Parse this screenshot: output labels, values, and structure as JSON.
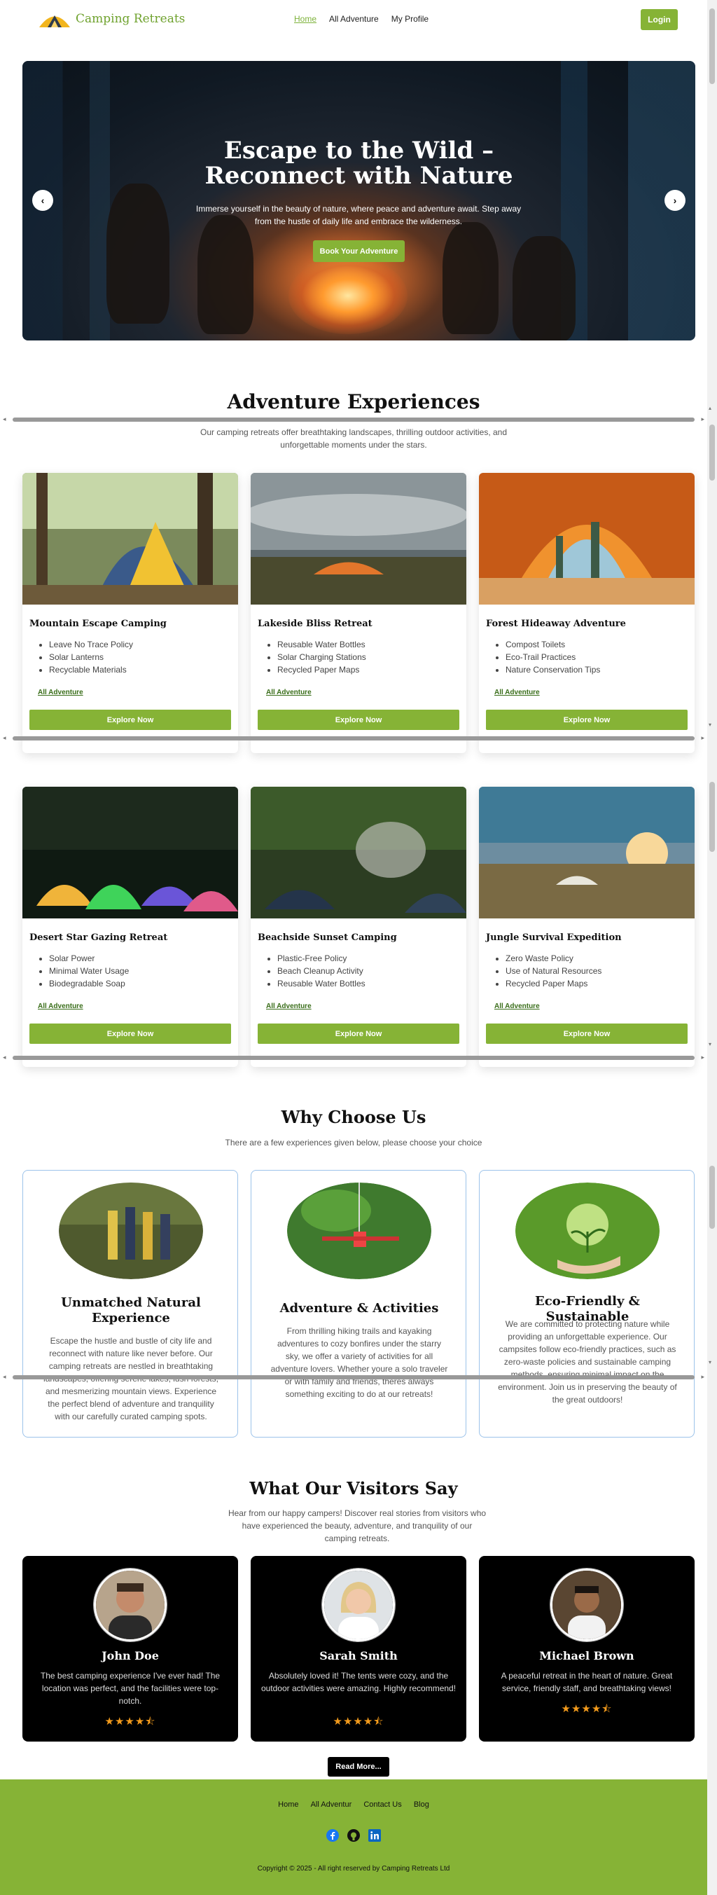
{
  "nav": {
    "brand": "Camping Retreats",
    "links": [
      "Home",
      "All Adventure",
      "My Profile"
    ],
    "login": "Login"
  },
  "hero": {
    "title_line1": "Escape to the Wild –",
    "title_line2": "Reconnect with Nature",
    "subtitle": "Immerse yourself in the beauty of nature, where peace and adventure await. Step away from the hustle of daily life and embrace the wilderness.",
    "cta": "Book Your Adventure",
    "prev_arrow": "‹",
    "next_arrow": "›"
  },
  "adventures": {
    "title": "Adventure Experiences",
    "subtitle": "Our camping retreats offer breathtaking landscapes, thrilling outdoor activities, and unforgettable moments under the stars.",
    "link_label": "All Adventure",
    "button_label": "Explore Now",
    "cards": [
      {
        "title": "Mountain Escape Camping",
        "items": [
          "Leave No Trace Policy",
          "Solar Lanterns",
          "Recyclable Materials"
        ]
      },
      {
        "title": "Lakeside Bliss Retreat",
        "items": [
          "Reusable Water Bottles",
          "Solar Charging Stations",
          "Recycled Paper Maps"
        ]
      },
      {
        "title": "Forest Hideaway Adventure",
        "items": [
          "Compost Toilets",
          "Eco-Trail Practices",
          "Nature Conservation Tips"
        ]
      },
      {
        "title": "Desert Star Gazing Retreat",
        "items": [
          "Solar Power",
          "Minimal Water Usage",
          "Biodegradable Soap"
        ]
      },
      {
        "title": "Beachside Sunset Camping",
        "items": [
          "Plastic-Free Policy",
          "Beach Cleanup Activity",
          "Reusable Water Bottles"
        ]
      },
      {
        "title": "Jungle Survival Expedition",
        "items": [
          "Zero Waste Policy",
          "Use of Natural Resources",
          "Recycled Paper Maps"
        ]
      }
    ]
  },
  "why": {
    "title": "Why Choose Us",
    "subtitle": "There are a few experiences given below, please choose your choice",
    "cards": [
      {
        "title": "Unmatched Natural Experience",
        "text": "Escape the hustle and bustle of city life and reconnect with nature like never before. Our camping retreats are nestled in breathtaking landscapes, offering serene lakes, lush forests, and mesmerizing mountain views. Experience the perfect blend of adventure and tranquility with our carefully curated camping spots."
      },
      {
        "title": "Adventure & Activities",
        "text": "From thrilling hiking trails and kayaking adventures to cozy bonfires under the starry sky, we offer a variety of activities for all adventure lovers. Whether youre a solo traveler or with family and friends, theres always something exciting to do at our retreats!"
      },
      {
        "title": "Eco-Friendly & Sustainable",
        "text": "We are committed to protecting nature while providing an unforgettable experience. Our campsites follow eco-friendly practices, such as zero-waste policies and sustainable camping methods, ensuring minimal impact on the environment. Join us in preserving the beauty of the great outdoors!"
      }
    ]
  },
  "testimonials": {
    "title": "What Our Visitors Say",
    "subtitle": "Hear from our happy campers! Discover real stories from visitors who have experienced the beauty, adventure, and tranquility of our camping retreats.",
    "items": [
      {
        "name": "John Doe",
        "text": "The best camping experience I've ever had! The location was perfect, and the facilities were top-notch.",
        "rating": 4.5,
        "stars": "★★★★⯪"
      },
      {
        "name": "Sarah Smith",
        "text": "Absolutely loved it! The tents were cozy, and the outdoor activities were amazing. Highly recommend!",
        "rating": 4.5,
        "stars": "★★★★⯪"
      },
      {
        "name": "Michael Brown",
        "text": "A peaceful retreat in the heart of nature. Great service, friendly staff, and breathtaking views!",
        "rating": 4.5,
        "stars": "★★★★⯪"
      }
    ],
    "read_more": "Read More..."
  },
  "footer": {
    "links": [
      "Home",
      "All Adventur",
      "Contact Us",
      "Blog"
    ],
    "icons": [
      "facebook-icon",
      "github-icon",
      "linkedin-icon"
    ],
    "copyright": "Copyright © 2025 - All right reserved by Camping Retreats Ltd"
  },
  "colors": {
    "accent": "#86b336",
    "brand_text": "#6fa22e",
    "why_border": "#9cc3ea",
    "star": "#f39b1c"
  }
}
